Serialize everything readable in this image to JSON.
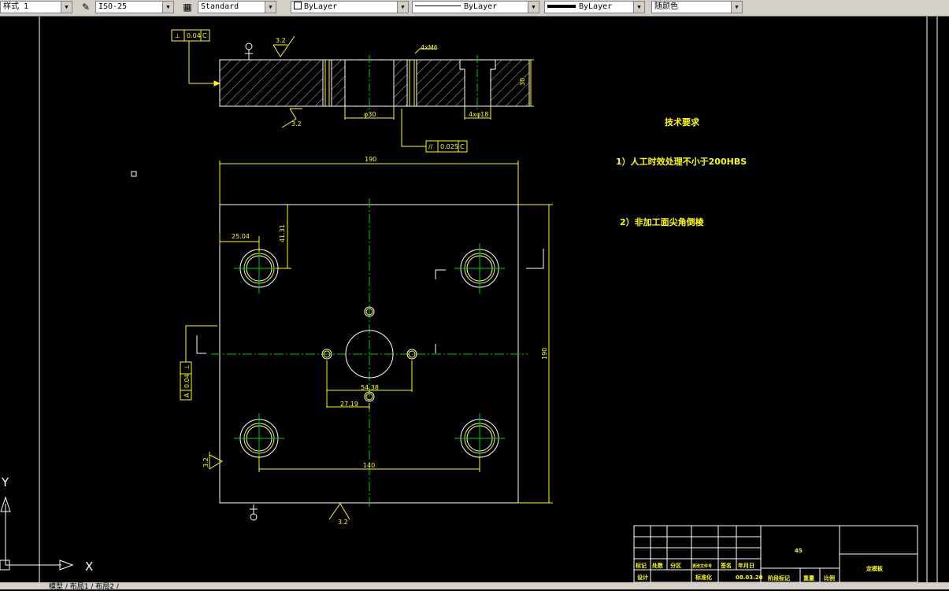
{
  "toolbar": {
    "text_style": "样式 1",
    "dim_style": "ISO-25",
    "table_style": "Standard",
    "layer_color": "ByLayer",
    "linetype": "ByLayer",
    "lineweight": "ByLayer",
    "plot_style": "随颜色"
  },
  "drawing": {
    "gdt_top": {
      "symbol": "⊥",
      "tol": "0.04",
      "datum": "C"
    },
    "gdt_parallel": {
      "symbol": "//",
      "tol": "0.025",
      "datum": "C"
    },
    "gdt_side": {
      "symbol": "⊥",
      "tol": "0.04",
      "datum": "A"
    },
    "rough_top": "3.2",
    "rough_bottom_top_view": "3.2",
    "rough_left": "3.2",
    "rough_bottom": "3.2",
    "hole_note_top": "4xM6",
    "dim_30": "30",
    "dim_phi30": "φ30",
    "hole_note_bottom": "4xφ18",
    "dim_190_top": "190",
    "dim_190_right": "190",
    "dim_25_04": "25.04",
    "dim_41_31": "41.31",
    "dim_54_38": "54.38",
    "dim_27_19": "27.19",
    "dim_140": "140"
  },
  "notes": {
    "title": "技术要求",
    "item1": "1）人工时效处理不小于200HBS",
    "item2": "2）非加工面尖角倒棱"
  },
  "title_block": {
    "material": "45",
    "part_name": "定模板",
    "labels": [
      "标记",
      "处数",
      "分区",
      "更改文件号",
      "签名",
      "年月日"
    ],
    "row2": [
      "设计",
      "标准化"
    ],
    "date": "08.03.20",
    "stage": "阶段标记",
    "weight": "重量",
    "scale": "比例"
  },
  "ucs": {
    "y_label": "Y",
    "x_label": "X"
  },
  "status": {
    "tabs": "模型 / 布局1 / 布局2 /"
  },
  "colors": {
    "dim": "#ffff00",
    "center": "#00cc00",
    "outline": "#ffffff"
  }
}
